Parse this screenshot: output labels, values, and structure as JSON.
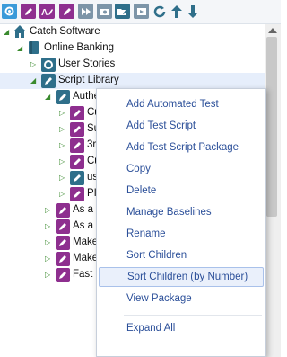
{
  "toolbar": {
    "buttons": [
      {
        "name": "settings-icon",
        "color": "#3a9ad9"
      },
      {
        "name": "pencil-icon",
        "color": "#8e2f8f"
      },
      {
        "name": "rename-icon",
        "color": "#8e2f8f"
      },
      {
        "name": "edit-icon",
        "color": "#8e2f8f"
      },
      {
        "name": "run-icon",
        "color": "#5b7c93"
      },
      {
        "name": "camera-icon",
        "color": "#2f6f8a"
      },
      {
        "name": "folder-edit-icon",
        "color": "#2f6f8a"
      },
      {
        "name": "play-icon",
        "color": "#5b7c93"
      },
      {
        "name": "refresh-icon",
        "color": "#2f6f8a"
      },
      {
        "name": "arrow-up-icon",
        "color": "#2f6f8a"
      },
      {
        "name": "arrow-down-icon",
        "color": "#2f6f8a"
      }
    ]
  },
  "tree": {
    "nodes": [
      {
        "label": "Catch Software",
        "icon": "home-icon"
      },
      {
        "label": "Online Banking",
        "icon": "book-icon"
      },
      {
        "label": "User Stories",
        "icon": "story-icon"
      },
      {
        "label": "Script Library",
        "icon": "script-icon"
      },
      {
        "label": "Auther",
        "icon": "script-icon"
      },
      {
        "label": "Cu",
        "icon": "test-icon"
      },
      {
        "label": "Suc",
        "icon": "test-icon"
      },
      {
        "label": "3rd",
        "icon": "test-icon"
      },
      {
        "label": "Cu",
        "icon": "test-icon"
      },
      {
        "label": "use",
        "icon": "script-icon"
      },
      {
        "label": "PIN",
        "icon": "test-icon"
      },
      {
        "label": "As a U",
        "icon": "test-icon"
      },
      {
        "label": "As a u",
        "icon": "test-icon"
      },
      {
        "label": "Make",
        "icon": "test-icon"
      },
      {
        "label": "Make",
        "icon": "test-icon"
      },
      {
        "label": "Fast C",
        "icon": "test-icon"
      }
    ]
  },
  "context_menu": {
    "items": [
      "Add Automated Test",
      "Add Test Script",
      "Add Test Script Package",
      "Copy",
      "Delete",
      "Manage Baselines",
      "Rename",
      "Sort Children",
      "Sort Children (by Number)",
      "View Package",
      "Expand All"
    ],
    "highlighted": "Sort Children (by Number)"
  },
  "colors": {
    "purple": "#8e2f8f",
    "teal": "#2f6f8a",
    "menu_text": "#2b4f99",
    "selection": "#e6eefb"
  }
}
